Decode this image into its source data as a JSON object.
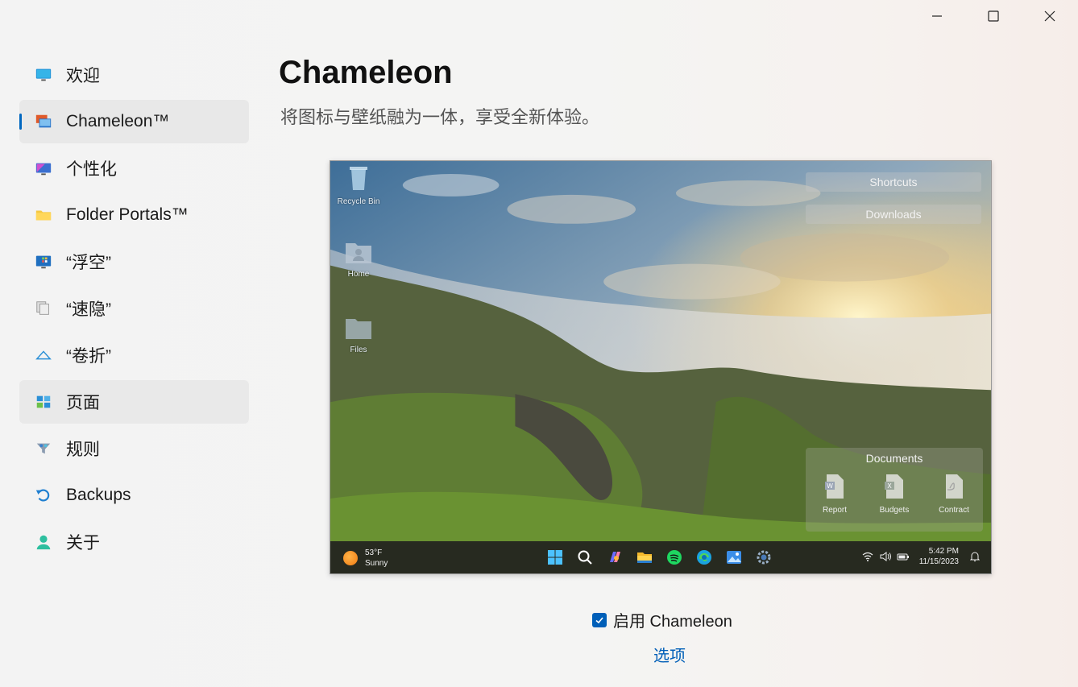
{
  "window": {
    "controls": [
      "minimize",
      "maximize",
      "close"
    ]
  },
  "sidebar": {
    "items": [
      {
        "label": "欢迎",
        "icon": "monitor-icon"
      },
      {
        "label": "Chameleon™",
        "icon": "chameleon-icon",
        "selected": true
      },
      {
        "label": "个性化",
        "icon": "personalize-icon"
      },
      {
        "label": "Folder Portals™",
        "icon": "folder-icon"
      },
      {
        "label": "“浮空”",
        "icon": "float-icon"
      },
      {
        "label": "“速隐”",
        "icon": "peek-icon"
      },
      {
        "label": "“卷折”",
        "icon": "rollup-icon"
      },
      {
        "label": "页面",
        "icon": "pages-icon",
        "hover": true
      },
      {
        "label": "规则",
        "icon": "rules-icon"
      },
      {
        "label": "Backups",
        "icon": "backup-icon"
      },
      {
        "label": "关于",
        "icon": "about-icon"
      }
    ]
  },
  "main": {
    "title": "Chameleon",
    "subtitle": "将图标与壁纸融为一体，享受全新体验。"
  },
  "preview": {
    "desktop_icons": [
      {
        "label": "Recycle Bin",
        "icon": "recycle-bin-icon"
      },
      {
        "label": "Home",
        "icon": "home-folder-icon"
      },
      {
        "label": "Files",
        "icon": "files-folder-icon"
      }
    ],
    "portals": {
      "shortcuts": "Shortcuts",
      "downloads": "Downloads",
      "documents": "Documents"
    },
    "documents": [
      {
        "label": "Report",
        "icon": "word-doc-icon"
      },
      {
        "label": "Budgets",
        "icon": "excel-doc-icon"
      },
      {
        "label": "Contract",
        "icon": "pdf-doc-icon"
      }
    ],
    "taskbar": {
      "weather_temp": "53°F",
      "weather_cond": "Sunny",
      "time": "5:42 PM",
      "date": "11/15/2023"
    }
  },
  "controls": {
    "enable_label": "启用 Chameleon",
    "enable_checked": true,
    "options_label": "选项"
  },
  "colors": {
    "accent": "#005fb8",
    "indicator": "#0067c0"
  }
}
